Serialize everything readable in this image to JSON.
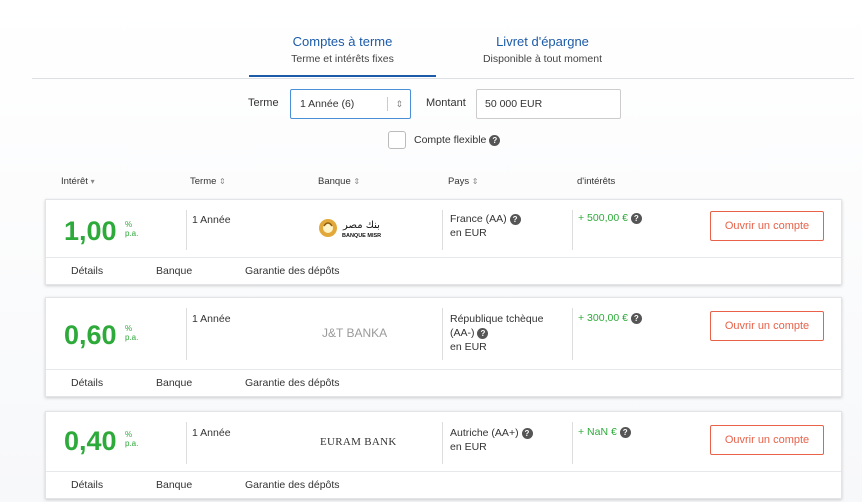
{
  "tabs": [
    {
      "title": "Comptes à terme",
      "subtitle": "Terme et intérêts fixes",
      "active": true
    },
    {
      "title": "Livret d'épargne",
      "subtitle": "Disponible à tout moment",
      "active": false
    }
  ],
  "filters": {
    "term_label": "Terme",
    "term_value": "1 Année (6)",
    "amount_label": "Montant",
    "amount_value": "50 000 EUR",
    "flexible_label": "Compte flexible"
  },
  "columns": {
    "interest": "Intérêt",
    "term": "Terme",
    "bank": "Banque",
    "country": "Pays",
    "earnings": "d'intérêts"
  },
  "icons": {
    "sort_desc": "▾",
    "sort_both": "⇕",
    "help": "?"
  },
  "offers": [
    {
      "rate": "1,00",
      "unit_pct": "%",
      "unit_pa": "p.a.",
      "term": "1 Année",
      "bank_logo_text": "BANQUE MISR",
      "bank_logo_arabic": "بنك مصر",
      "country_lines": [
        "France (AA)",
        "en EUR"
      ],
      "earnings": "+ 500,00 €",
      "cta": "Ouvrir un compte"
    },
    {
      "rate": "0,60",
      "unit_pct": "%",
      "unit_pa": "p.a.",
      "term": "1 Année",
      "bank_logo_text": "J&T BANKA",
      "country_lines": [
        "République tchèque",
        "(AA-)",
        "en EUR"
      ],
      "earnings": "+ 300,00 €",
      "cta": "Ouvrir un compte"
    },
    {
      "rate": "0,40",
      "unit_pct": "%",
      "unit_pa": "p.a.",
      "term": "1 Année",
      "bank_logo_text": "EURAM BANK",
      "country_lines": [
        "Autriche (AA+)",
        "en EUR"
      ],
      "earnings": "+ NaN €",
      "cta": "Ouvrir un compte"
    }
  ],
  "footer_links": {
    "details": "Détails",
    "bank": "Banque",
    "guarantee": "Garantie des dépôts"
  },
  "colors": {
    "accent_blue": "#1c5ba8",
    "rate_green": "#2daa3a",
    "cta_orange": "#e8624a"
  }
}
